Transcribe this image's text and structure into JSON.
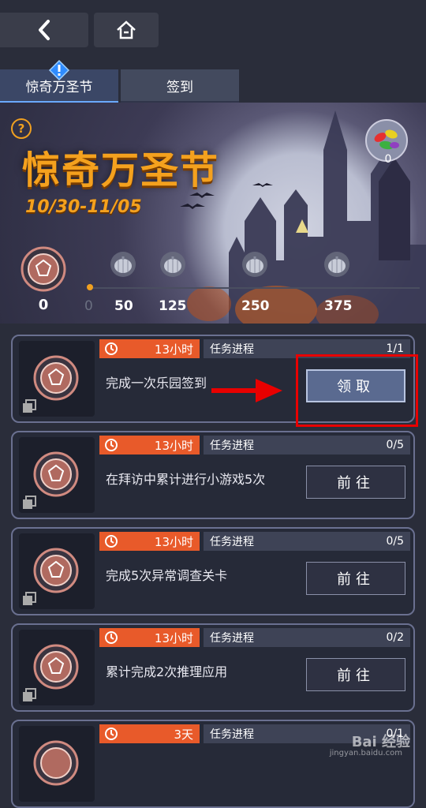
{
  "nav": {
    "back_icon": "chevron-left-icon",
    "home_icon": "home-icon"
  },
  "tabs": [
    {
      "label": "惊奇万圣节",
      "active": true,
      "alert": true
    },
    {
      "label": "签到",
      "active": false
    }
  ],
  "event": {
    "title": "惊奇万圣节",
    "dates": "10/30-11/05",
    "help_symbol": "?",
    "candy_count": "0",
    "current_points": "0",
    "milestones": [
      "0",
      "50",
      "125",
      "250",
      "375"
    ],
    "progress": 0
  },
  "tasks": [
    {
      "time": "13小时",
      "progress_label": "任务进程",
      "progress": "1/1",
      "description": "完成一次乐园签到",
      "action": "领取",
      "claimable": true
    },
    {
      "time": "13小时",
      "progress_label": "任务进程",
      "progress": "0/5",
      "description": "在拜访中累计进行小游戏5次",
      "action": "前往",
      "claimable": false
    },
    {
      "time": "13小时",
      "progress_label": "任务进程",
      "progress": "0/5",
      "description": "完成5次异常调查关卡",
      "action": "前往",
      "claimable": false
    },
    {
      "time": "13小时",
      "progress_label": "任务进程",
      "progress": "0/2",
      "description": "累计完成2次推理应用",
      "action": "前往",
      "claimable": false
    },
    {
      "time": "3天",
      "progress_label": "任务进程",
      "progress": "0/1",
      "description": "",
      "action": "",
      "claimable": false
    }
  ],
  "watermark": {
    "brand": "Bai 经验",
    "url": "jingyan.baidu.com"
  },
  "colors": {
    "accent_orange": "#f4a11e",
    "badge_red": "#e85a2a",
    "highlight_red": "#e80000",
    "tab_active_line": "#6aa9ff"
  }
}
